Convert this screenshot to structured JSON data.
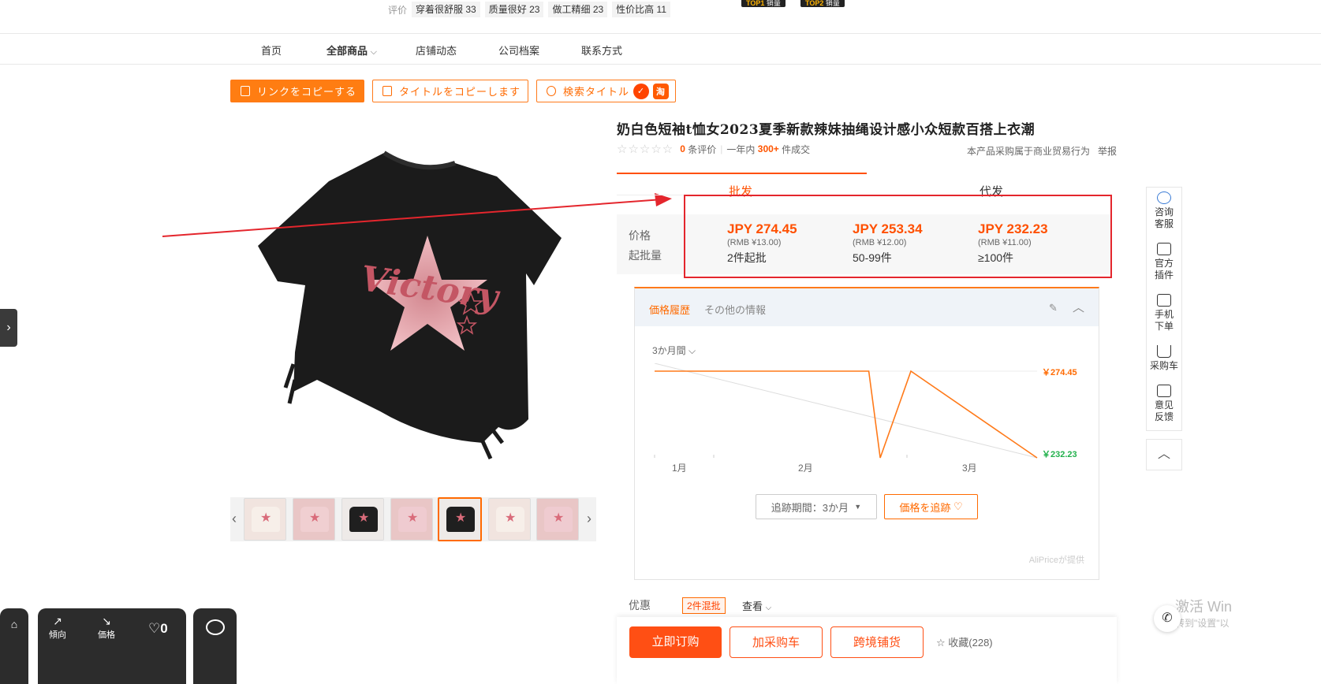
{
  "review_strip": {
    "label": "评价",
    "tags": [
      {
        "text": "穿着很舒服",
        "count": "33"
      },
      {
        "text": "质量很好",
        "count": "23"
      },
      {
        "text": "做工精细",
        "count": "23"
      },
      {
        "text": "性价比高",
        "count": "11"
      }
    ],
    "badges": [
      {
        "rank": "TOP1",
        "text": "销量"
      },
      {
        "rank": "TOP2",
        "text": "销量"
      }
    ]
  },
  "nav": {
    "items": [
      "首页",
      "全部商品",
      "店铺动态",
      "公司档案",
      "联系方式"
    ]
  },
  "actions": {
    "copy_link": "リンクをコピーする",
    "copy_title": "タイトルをコピーします",
    "search_title": "検索タイトル",
    "logo_taobao": "淘"
  },
  "product": {
    "title": "奶白色短袖t恤女2023夏季新款辣妹抽绳设计感小众短款百搭上衣潮",
    "rating_stars": "☆☆☆☆☆",
    "review_count": "0",
    "review_suffix": "条评价",
    "sold_prefix": "一年内",
    "sold_count": "300+",
    "sold_suffix": "件成交",
    "commercial_note": "本产品采购属于商业贸易行为",
    "report": "举报",
    "image_text": "Victory"
  },
  "tabs": {
    "wholesale": "批发",
    "dropship": "代发"
  },
  "price": {
    "label_price": "价格",
    "label_moq": "起批量",
    "tiers": [
      {
        "price": "JPY 274.45",
        "rmb": "(RMB ¥13.00)",
        "qty": "2件起批"
      },
      {
        "price": "JPY 253.34",
        "rmb": "(RMB ¥12.00)",
        "qty": "50-99件"
      },
      {
        "price": "JPY 232.23",
        "rmb": "(RMB ¥11.00)",
        "qty": "≥100件"
      }
    ]
  },
  "aliprice": {
    "tab_history": "価格履歴",
    "tab_other": "その他の情報",
    "range": "3か月間",
    "chart_data": {
      "type": "line",
      "x_labels": [
        "1月",
        "2月",
        "3月"
      ],
      "series": [
        {
          "values": [
            {
              "x": 0,
              "y": 274.45
            },
            {
              "x": 0.56,
              "y": 274.45
            },
            {
              "x": 0.59,
              "y": 232.23
            },
            {
              "x": 0.67,
              "y": 274.45
            },
            {
              "x": 1.0,
              "y": 232.23
            }
          ]
        }
      ],
      "max_label": "￥274.45",
      "min_label": "￥232.23",
      "colors": {
        "line": "#ff7a1a",
        "max": "#ff6a00",
        "min": "#22b14c"
      }
    },
    "track_period": "追跡期間：3か月",
    "track_button": "価格を追跡",
    "provider": "AliPriceが提供"
  },
  "bottom": {
    "promo_label": "优惠",
    "promo_badge": "2件混批",
    "view": "查看",
    "buy_now": "立即订购",
    "add_cart": "加采购车",
    "cross_border": "跨境铺货",
    "favorite": "收藏(228)"
  },
  "sidebar": {
    "items": [
      "咨询客服",
      "官方插件",
      "手机下单",
      "采购车",
      "意见反馈"
    ]
  },
  "left_toolbar": {
    "trend": "傾向",
    "price": "価格",
    "likes": "0"
  },
  "watermark": {
    "line1": "激活 Win",
    "line2": "转到\"设置\"以"
  }
}
